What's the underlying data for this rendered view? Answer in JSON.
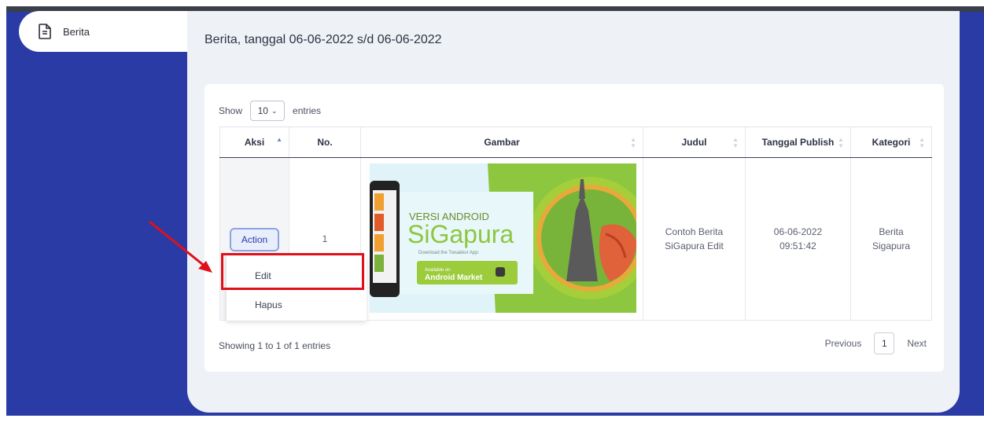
{
  "sidebar": {
    "item_label": "Berita",
    "item_icon": "document-icon"
  },
  "main": {
    "title": "Berita, tanggal 06-06-2022 s/d 06-06-2022"
  },
  "table_controls": {
    "show_label": "Show",
    "page_size": "10",
    "entries_label": "entries"
  },
  "table": {
    "headers": [
      "Aksi",
      "No.",
      "Gambar",
      "Judul",
      "Tanggal Publish",
      "Kategori"
    ],
    "row": {
      "action_label": "Action",
      "no": "1",
      "judul_line1": "Contoh Berita",
      "judul_line2": "SiGapura Edit",
      "tanggal_line1": "06-06-2022",
      "tanggal_line2": "09:51:42",
      "kategori_line1": "Berita",
      "kategori_line2": "Sigapura"
    }
  },
  "dropdown": {
    "edit_label": "Edit",
    "hapus_label": "Hapus"
  },
  "banner": {
    "versi": "VERSI ANDROID",
    "brand": "SiGapura",
    "download": "Download the Twsakkor App:",
    "available": "Available on",
    "market": "Android Market"
  },
  "footer": {
    "info": "Showing 1 to 1 of 1 entries",
    "previous": "Previous",
    "page": "1",
    "next": "Next"
  },
  "colors": {
    "sidebar_blue": "#2a3ba6",
    "highlight_red": "#e0101a",
    "accent": "#8ea4e0"
  }
}
